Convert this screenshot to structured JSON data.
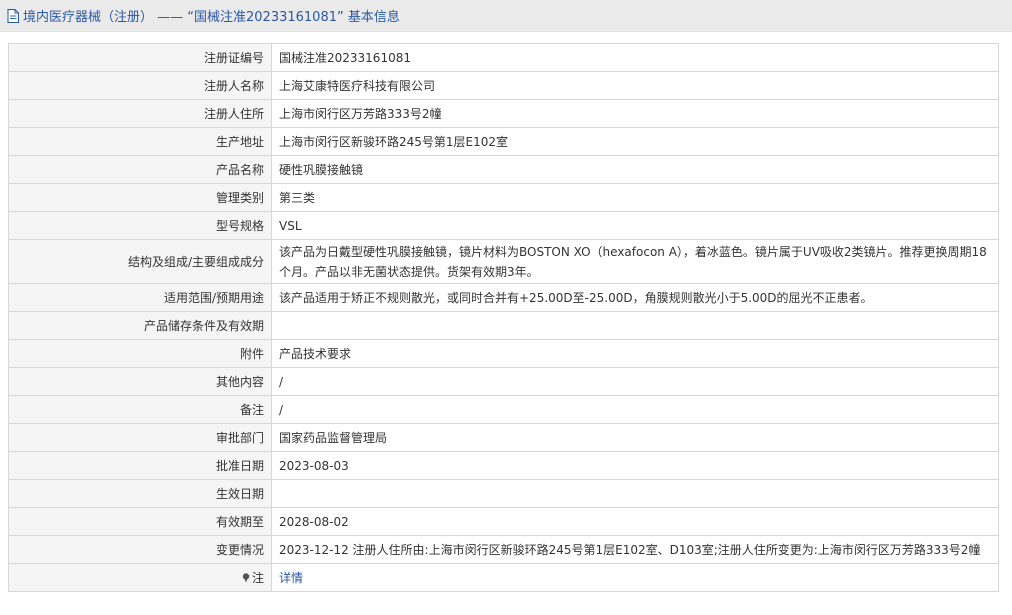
{
  "header": {
    "title": "境内医疗器械（注册） ——  “国械注准20233161081” 基本信息",
    "icon": "document-icon"
  },
  "rows": [
    {
      "label": "注册证编号",
      "value": "国械注准20233161081"
    },
    {
      "label": "注册人名称",
      "value": "上海艾康特医疗科技有限公司"
    },
    {
      "label": "注册人住所",
      "value": "上海市闵行区万芳路333号2幢"
    },
    {
      "label": "生产地址",
      "value": "上海市闵行区新骏环路245号第1层E102室"
    },
    {
      "label": "产品名称",
      "value": "硬性巩膜接触镜"
    },
    {
      "label": "管理类别",
      "value": "第三类"
    },
    {
      "label": "型号规格",
      "value": "VSL"
    },
    {
      "label": "结构及组成/主要组成成分",
      "value": "该产品为日戴型硬性巩膜接触镜，镜片材料为BOSTON XO（hexafocon A），着冰蓝色。镜片属于UV吸收2类镜片。推荐更换周期18个月。产品以非无菌状态提供。货架有效期3年。"
    },
    {
      "label": "适用范围/预期用途",
      "value": "该产品适用于矫正不规则散光，或同时合并有+25.00D至-25.00D，角膜规则散光小于5.00D的屈光不正患者。"
    },
    {
      "label": "产品储存条件及有效期",
      "value": ""
    },
    {
      "label": "附件",
      "value": "产品技术要求"
    },
    {
      "label": "其他内容",
      "value": "/"
    },
    {
      "label": "备注",
      "value": "/"
    },
    {
      "label": "审批部门",
      "value": "国家药品监督管理局"
    },
    {
      "label": "批准日期",
      "value": "2023-08-03"
    },
    {
      "label": "生效日期",
      "value": ""
    },
    {
      "label": "有效期至",
      "value": "2028-08-02"
    },
    {
      "label": "变更情况",
      "value": "2023-12-12 注册人住所由:上海市闵行区新骏环路245号第1层E102室、D103室;注册人住所变更为:上海市闵行区万芳路333号2幢"
    },
    {
      "label": "注",
      "value": "详情"
    }
  ],
  "colors": {
    "link": "#2a58a6",
    "label_bg": "#f5f5f5",
    "border": "#d7d7d7",
    "title_bar_bg": "#eaeaea"
  }
}
